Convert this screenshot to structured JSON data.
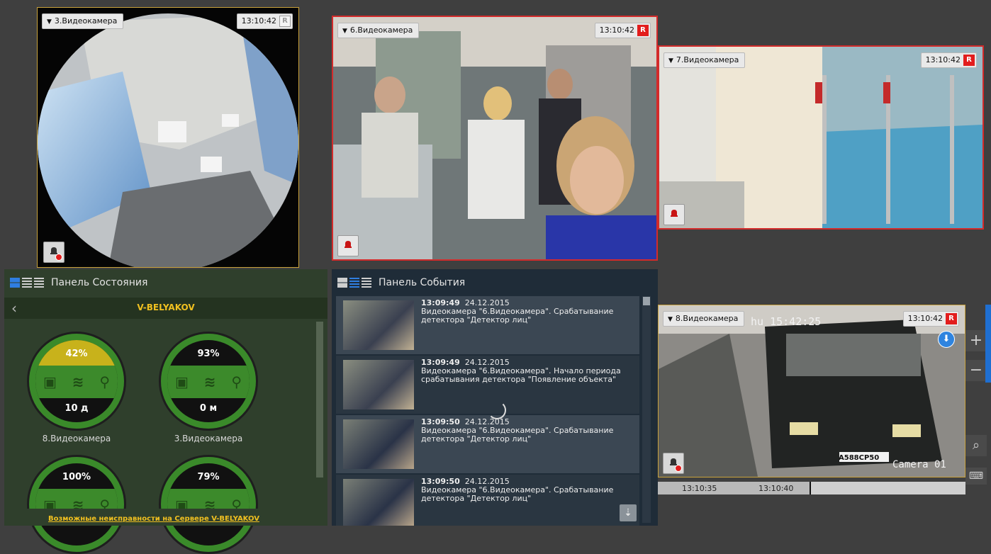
{
  "cameras": [
    {
      "id": "cam3",
      "label": "3.Видеокамера",
      "time": "13:10:42",
      "rec": "R"
    },
    {
      "id": "cam6",
      "label": "6.Видеокамера",
      "time": "13:10:42",
      "rec": "R"
    },
    {
      "id": "cam7",
      "label": "7.Видеокамера",
      "time": "13:10:42",
      "rec": "R"
    },
    {
      "id": "cam8",
      "label": "8.Видеокамера",
      "time": "13:10:42",
      "rec": "R"
    }
  ],
  "cam8_overlay": {
    "osd_time": "hu 15:42:25",
    "plate": "A588CP50",
    "osd_name": "Camera 01"
  },
  "timeline": {
    "ticks": [
      "13:10:35",
      "13:10:40"
    ]
  },
  "status_panel": {
    "title": "Панель Состояния",
    "server": "V-BELYAKOV",
    "footer_link": "Возможные неисправности на Сервере V-BELYAKOV",
    "gauges": [
      {
        "name": "8.Видеокамера",
        "percent": "42%",
        "bottom": "10 д",
        "level": 0.42
      },
      {
        "name": "3.Видеокамера",
        "percent": "93%",
        "bottom": "0 м",
        "level": 0.93
      },
      {
        "name": "",
        "percent": "100%",
        "bottom": "",
        "level": 1.0
      },
      {
        "name": "",
        "percent": "79%",
        "bottom": "",
        "level": 0.79
      }
    ]
  },
  "events_panel": {
    "title": "Панель События",
    "events": [
      {
        "time": "13:09:49",
        "date": "24.12.2015",
        "text": "Видеокамера \"6.Видеокамера\". Срабатывание детектора \"Детектор лиц\""
      },
      {
        "time": "13:09:49",
        "date": "24.12.2015",
        "text": "Видеокамера \"6.Видеокамера\". Начало периода срабатывания детектора \"Появление объекта\""
      },
      {
        "time": "13:09:50",
        "date": "24.12.2015",
        "text": "Видеокамера \"6.Видеокамера\". Срабатывание детектора \"Детектор лиц\""
      },
      {
        "time": "13:09:50",
        "date": "24.12.2015",
        "text": "Видеокамера \"6.Видеокамера\". Срабатывание детектора \"Детектор лиц\""
      }
    ]
  },
  "side_controls": {
    "zoom_in": "+",
    "zoom_out": "−"
  },
  "colors": {
    "accent_blue": "#1f6fd1",
    "record_red": "#e21d1d",
    "gauge_green": "#3a8a2a",
    "gauge_yellow": "#c8b21b",
    "link_yellow": "#f0c020"
  }
}
